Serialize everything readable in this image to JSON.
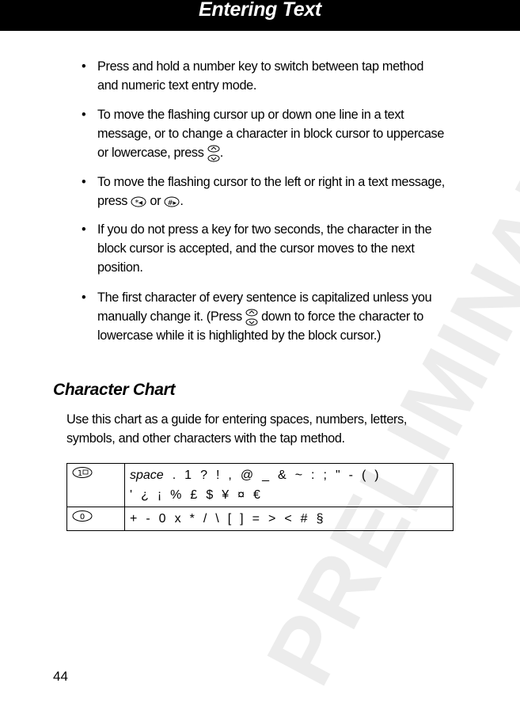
{
  "header": {
    "title": "Entering Text"
  },
  "watermark": "PRELIMINARY",
  "bullets": [
    {
      "text": "Press and hold a number key to switch between tap method and numeric text entry mode."
    },
    {
      "before": "To move the flashing cursor up or down one line in a text message, or to change a character in block cursor to uppercase or lowercase, press ",
      "after": "."
    },
    {
      "before": "To move the flashing cursor to the left or right in a text message, press ",
      "middle": " or ",
      "after": "."
    },
    {
      "text": "If you do not press a key for two seconds, the character in the block cursor is accepted, and the cursor moves to the next position."
    },
    {
      "before": "The first character of every sentence is capitalized unless you manually change it. (Press ",
      "after": " down to force the character to lowercase while it is highlighted by the block cursor.)"
    }
  ],
  "section": {
    "heading": "Character Chart",
    "intro": "Use this chart as a guide for entering spaces, numbers, letters, symbols, and other characters with the tap method."
  },
  "chart": {
    "rows": [
      {
        "key": "1",
        "key_icon": "key-1-voicemail",
        "line1": [
          "space",
          ".",
          "1",
          "?",
          "!",
          ",",
          "@",
          "_",
          "&",
          "~",
          ":",
          ";",
          "\"",
          "-",
          "(",
          ")"
        ],
        "line2": [
          "'",
          "¿",
          "¡",
          "%",
          "£",
          "$",
          "¥",
          "¤",
          "€"
        ]
      },
      {
        "key": "0",
        "key_icon": "key-0",
        "line1": [
          "+",
          "-",
          "0",
          "x",
          "*",
          "/",
          "\\",
          "[",
          "]",
          "=",
          ">",
          "<",
          "#",
          "§"
        ]
      }
    ]
  },
  "page_number": "44"
}
